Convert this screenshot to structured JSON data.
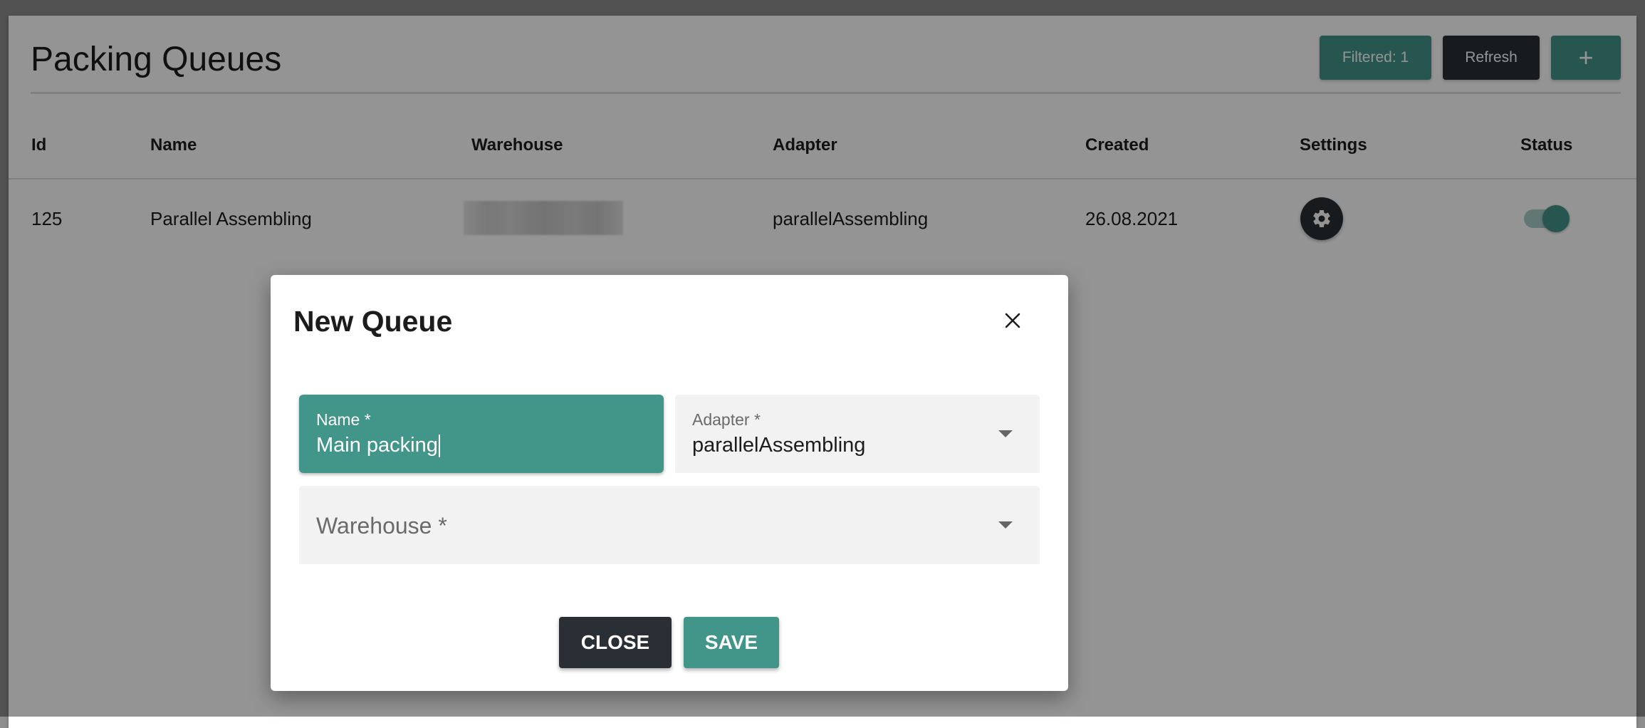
{
  "page": {
    "title": "Packing Queues"
  },
  "toolbar": {
    "filtered_label": "Filtered: 1",
    "refresh_label": "Refresh",
    "add_label": "+"
  },
  "table": {
    "headers": {
      "id": "Id",
      "name": "Name",
      "warehouse": "Warehouse",
      "adapter": "Adapter",
      "created": "Created",
      "settings": "Settings",
      "status": "Status"
    },
    "rows": [
      {
        "id": "125",
        "name": "Parallel Assembling",
        "adapter": "parallelAssembling",
        "created": "26.08.2021",
        "status_on": true
      }
    ]
  },
  "dialog": {
    "title": "New Queue",
    "name_field": {
      "label": "Name *",
      "value": "Main packing"
    },
    "adapter_field": {
      "label": "Adapter *",
      "value": "parallelAssembling"
    },
    "warehouse_field": {
      "placeholder": "Warehouse *"
    },
    "close_label": "CLOSE",
    "save_label": "SAVE"
  },
  "colors": {
    "accent": "#429589",
    "dark": "#2a2f35",
    "overlay": "rgba(0,0,0,0.42)"
  },
  "icons": {
    "settings": "gear-icon",
    "close": "close-icon",
    "dropdown": "chevron-down-icon"
  }
}
